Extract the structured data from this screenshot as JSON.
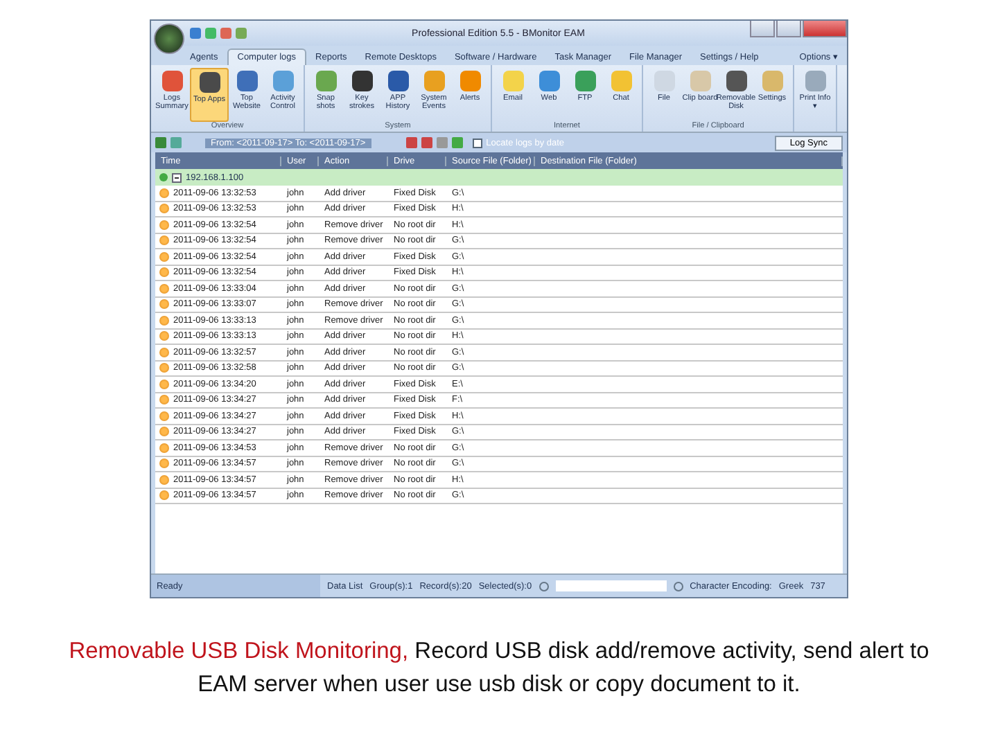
{
  "window": {
    "title": "Professional Edition 5.5 - BMonitor EAM"
  },
  "tabs": [
    {
      "label": "Agents",
      "selected": false
    },
    {
      "label": "Computer logs",
      "selected": true
    },
    {
      "label": "Reports",
      "selected": false
    },
    {
      "label": "Remote Desktops",
      "selected": false
    },
    {
      "label": "Software / Hardware",
      "selected": false
    },
    {
      "label": "Task Manager",
      "selected": false
    },
    {
      "label": "File Manager",
      "selected": false
    },
    {
      "label": "Settings / Help",
      "selected": false
    }
  ],
  "options_menu": "Options ▾",
  "ribbon": [
    {
      "label": "Overview",
      "buttons": [
        {
          "label": "Logs Summary",
          "selected": false
        },
        {
          "label": "Top Apps",
          "selected": true
        },
        {
          "label": "Top Website",
          "selected": false
        },
        {
          "label": "Activity Control",
          "selected": false
        }
      ]
    },
    {
      "label": "System",
      "buttons": [
        {
          "label": "Snap shots",
          "selected": false
        },
        {
          "label": "Key strokes",
          "selected": false
        },
        {
          "label": "APP History",
          "selected": false
        },
        {
          "label": "System Events",
          "selected": false
        },
        {
          "label": "Alerts",
          "selected": false
        }
      ]
    },
    {
      "label": "Internet",
      "buttons": [
        {
          "label": "Email",
          "selected": false
        },
        {
          "label": "Web",
          "selected": false
        },
        {
          "label": "FTP",
          "selected": false
        },
        {
          "label": "Chat",
          "selected": false
        }
      ]
    },
    {
      "label": "File / Clipboard",
      "buttons": [
        {
          "label": "File",
          "selected": false
        },
        {
          "label": "Clip board",
          "selected": false
        },
        {
          "label": "Removable Disk",
          "selected": false
        },
        {
          "label": "Settings",
          "selected": false
        }
      ]
    },
    {
      "buttons": [
        {
          "label": "Print Info ▾",
          "selected": false
        }
      ]
    }
  ],
  "toolbar": {
    "date_range": "From: <2011-09-17> To: <2011-09-17>",
    "locate_by_date": {
      "label": "Locate logs by date",
      "checked": false
    },
    "sync_button": "Log Sync"
  },
  "table": {
    "columns": [
      "Time",
      "User",
      "Action",
      "Drive",
      "Source File (Folder)",
      "Destination File (Folder)"
    ],
    "group": {
      "label": "192.168.1.100",
      "expanded": true
    },
    "rows": [
      [
        "2011-09-06 13:32:53",
        "john",
        "Add driver",
        "Fixed Disk",
        "G:\\"
      ],
      [
        "2011-09-06 13:32:53",
        "john",
        "Add driver",
        "Fixed Disk",
        "H:\\"
      ],
      [
        "2011-09-06 13:32:54",
        "john",
        "Remove driver",
        "No root dir",
        "H:\\"
      ],
      [
        "2011-09-06 13:32:54",
        "john",
        "Remove driver",
        "No root dir",
        "G:\\"
      ],
      [
        "2011-09-06 13:32:54",
        "john",
        "Add driver",
        "Fixed Disk",
        "G:\\"
      ],
      [
        "2011-09-06 13:32:54",
        "john",
        "Add driver",
        "Fixed Disk",
        "H:\\"
      ],
      [
        "2011-09-06 13:33:04",
        "john",
        "Add driver",
        "No root dir",
        "G:\\"
      ],
      [
        "2011-09-06 13:33:07",
        "john",
        "Remove driver",
        "No root dir",
        "G:\\"
      ],
      [
        "2011-09-06 13:33:13",
        "john",
        "Remove driver",
        "No root dir",
        "G:\\"
      ],
      [
        "2011-09-06 13:33:13",
        "john",
        "Add driver",
        "No root dir",
        "H:\\"
      ],
      [
        "2011-09-06 13:32:57",
        "john",
        "Add driver",
        "No root dir",
        "G:\\"
      ],
      [
        "2011-09-06 13:32:58",
        "john",
        "Add driver",
        "No root dir",
        "G:\\"
      ],
      [
        "2011-09-06 13:34:20",
        "john",
        "Add driver",
        "Fixed Disk",
        "E:\\"
      ],
      [
        "2011-09-06 13:34:27",
        "john",
        "Add driver",
        "Fixed Disk",
        "F:\\"
      ],
      [
        "2011-09-06 13:34:27",
        "john",
        "Add driver",
        "Fixed Disk",
        "H:\\"
      ],
      [
        "2011-09-06 13:34:27",
        "john",
        "Add driver",
        "Fixed Disk",
        "G:\\"
      ],
      [
        "2011-09-06 13:34:53",
        "john",
        "Remove driver",
        "No root dir",
        "G:\\"
      ],
      [
        "2011-09-06 13:34:57",
        "john",
        "Remove driver",
        "No root dir",
        "G:\\"
      ],
      [
        "2011-09-06 13:34:57",
        "john",
        "Remove driver",
        "No root dir",
        "H:\\"
      ],
      [
        "2011-09-06 13:34:57",
        "john",
        "Remove driver",
        "No root dir",
        "G:\\"
      ]
    ]
  },
  "status_bar": {
    "state": "Ready",
    "items": [
      "Data List",
      "Group(s):1",
      "Record(s):20",
      "Selected(s):0"
    ],
    "encoding_label": "Character Encoding:",
    "encoding": "Greek",
    "code_page": "737"
  },
  "caption": {
    "highlight": "Removable USB Disk Monitoring,",
    "text": " Record USB disk add/remove activity, send alert to EAM server when user use usb disk or copy document to it."
  }
}
